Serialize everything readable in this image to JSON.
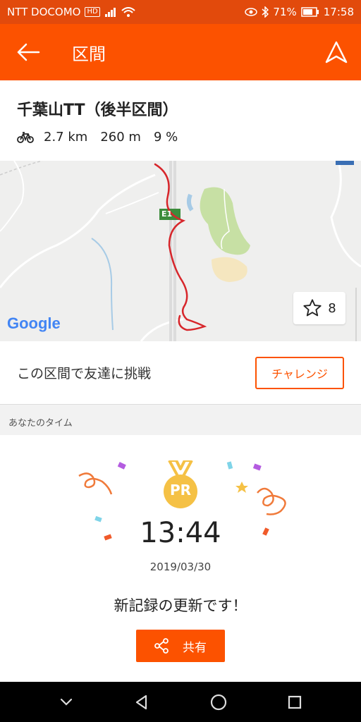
{
  "status_bar": {
    "carrier": "NTT DOCOMO",
    "hd": "HD",
    "battery": "71%",
    "time": "17:58"
  },
  "app_bar": {
    "title": "区間"
  },
  "segment": {
    "name": "千葉山TT（後半区間）",
    "distance": "2.7 km",
    "elevation": "260 m",
    "grade": "9 %"
  },
  "map": {
    "google_label": "Google",
    "star_count": "8",
    "road_label": "E1"
  },
  "challenge": {
    "text": "この区間で友達に挑戦",
    "button_label": "チャレンジ"
  },
  "section": {
    "your_time_label": "あなたのタイム"
  },
  "result": {
    "badge": "PR",
    "time": "13:44",
    "date": "2019/03/30",
    "message": "新記録の更新です！",
    "share_label": "共有"
  },
  "colors": {
    "brand": "#fc5200",
    "status_bar": "#e24a0c",
    "route": "#d7262b",
    "medal": "#f5c145"
  }
}
